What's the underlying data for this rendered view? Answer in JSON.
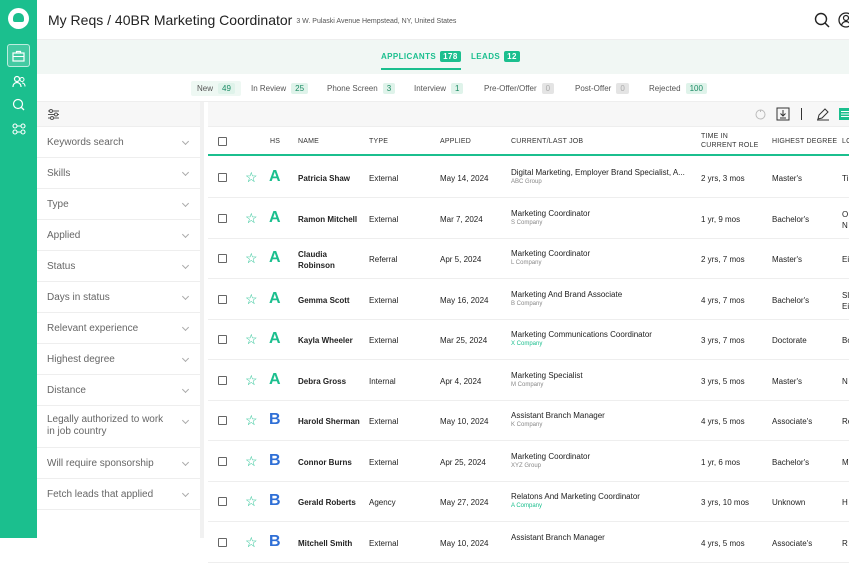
{
  "header": {
    "title": "My Reqs / 40BR Marketing Coordinator",
    "address": "3 W. Pulaski Avenue Hempstead, NY, United States"
  },
  "main_tabs": [
    {
      "label": "APPLICANTS",
      "count": "178",
      "active": true
    },
    {
      "label": "LEADS",
      "count": "12",
      "active": false
    }
  ],
  "status_tabs": [
    {
      "label": "New",
      "count": "49",
      "active": true,
      "zero": false
    },
    {
      "label": "In Review",
      "count": "25",
      "active": false,
      "zero": false
    },
    {
      "label": "Phone Screen",
      "count": "3",
      "active": false,
      "zero": false
    },
    {
      "label": "Interview",
      "count": "1",
      "active": false,
      "zero": false
    },
    {
      "label": "Pre-Offer/Offer",
      "count": "0",
      "active": false,
      "zero": true
    },
    {
      "label": "Post-Offer",
      "count": "0",
      "active": false,
      "zero": true
    },
    {
      "label": "Rejected",
      "count": "100",
      "active": false,
      "zero": false
    }
  ],
  "filters": [
    "Keywords search",
    "Skills",
    "Type",
    "Applied",
    "Status",
    "Days in status",
    "Relevant experience",
    "Highest degree",
    "Distance",
    "Legally authorized to work in job country",
    "Will require sponsorship",
    "Fetch leads that applied"
  ],
  "columns": {
    "hs": "HS",
    "name": "NAME",
    "type": "TYPE",
    "applied": "APPLIED",
    "job": "CURRENT/LAST JOB",
    "time": "TIME IN CURRENT ROLE",
    "degree": "HIGHEST DEGREE",
    "loc": "LC"
  },
  "rows": [
    {
      "grade": "A",
      "name": "Patricia Shaw",
      "type": "External",
      "applied": "May 14, 2024",
      "job": "Digital Marketing, Employer Brand Specialist, A...",
      "company": "ABC Group",
      "company_link": false,
      "time": "2 yrs, 3 mos",
      "degree": "Master's",
      "loc": "Ti"
    },
    {
      "grade": "A",
      "name": "Ramon Mitchell",
      "type": "External",
      "applied": "Mar 7, 2024",
      "job": "Marketing Coordinator",
      "company": "S Company",
      "company_link": false,
      "time": "1 yr, 9 mos",
      "degree": "Bachelor's",
      "loc": "O N"
    },
    {
      "grade": "A",
      "name": "Claudia Robinson",
      "type": "Referral",
      "applied": "Apr 5, 2024",
      "job": "Marketing Coordinator",
      "company": "L Company",
      "company_link": false,
      "time": "2 yrs, 7 mos",
      "degree": "Master's",
      "loc": "Ei"
    },
    {
      "grade": "A",
      "name": "Gemma Scott",
      "type": "External",
      "applied": "May 16, 2024",
      "job": "Marketing And Brand Associate",
      "company": "B Company",
      "company_link": false,
      "time": "4 yrs, 7 mos",
      "degree": "Bachelor's",
      "loc": "Sl Ei"
    },
    {
      "grade": "A",
      "name": "Kayla Wheeler",
      "type": "External",
      "applied": "Mar 25, 2024",
      "job": "Marketing Communications Coordinator",
      "company": "X Company",
      "company_link": true,
      "time": "3 yrs, 7 mos",
      "degree": "Doctorate",
      "loc": "Bo"
    },
    {
      "grade": "A",
      "name": "Debra Gross",
      "type": "Internal",
      "applied": "Apr 4, 2024",
      "job": "Marketing Specialist",
      "company": "M Company",
      "company_link": false,
      "time": "3 yrs, 5 mos",
      "degree": "Master's",
      "loc": "N"
    },
    {
      "grade": "B",
      "name": "Harold Sherman",
      "type": "External",
      "applied": "May 10, 2024",
      "job": "Assistant Branch Manager",
      "company": "K Company",
      "company_link": false,
      "time": "4 yrs, 5 mos",
      "degree": "Associate's",
      "loc": "Re"
    },
    {
      "grade": "B",
      "name": "Connor Burns",
      "type": "External",
      "applied": "Apr 25, 2024",
      "job": "Marketing Coordinator",
      "company": "XYZ Group",
      "company_link": false,
      "time": "1 yr, 6 mos",
      "degree": "Bachelor's",
      "loc": "M"
    },
    {
      "grade": "B",
      "name": "Gerald Roberts",
      "type": "Agency",
      "applied": "May 27, 2024",
      "job": "Relatons And Marketing Coordinator",
      "company": "A Company",
      "company_link": true,
      "time": "3 yrs, 10 mos",
      "degree": "Unknown",
      "loc": "H"
    },
    {
      "grade": "B",
      "name": "Mitchell Smith",
      "type": "External",
      "applied": "May 10, 2024",
      "job": "Assistant Branch Manager",
      "company": "",
      "company_link": false,
      "time": "4 yrs, 5 mos",
      "degree": "Associate's",
      "loc": "R"
    }
  ],
  "colors": {
    "accent": "#1bbf8e",
    "grade_b": "#2f6fd6"
  }
}
